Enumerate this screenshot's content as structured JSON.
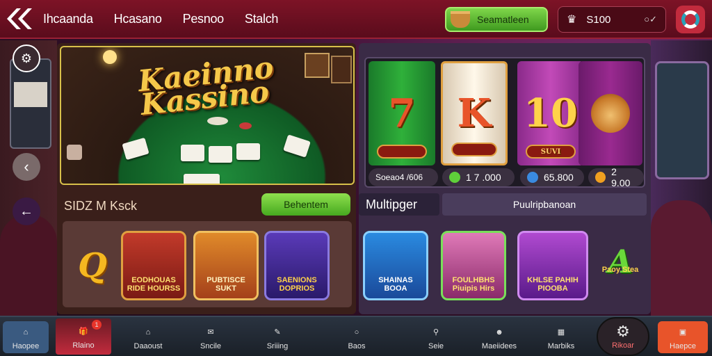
{
  "topbar": {
    "nav": [
      "Ihcaanda",
      "Hcasano",
      "Pesnoo",
      "Stalch"
    ],
    "promo_label": "Seamatleen",
    "balance": "S100",
    "balance_chevron": "○✓"
  },
  "hero": {
    "title_line1": "Kaeinno",
    "title_line2": "Kassino"
  },
  "left_section": {
    "title": "SIDZ M Ksck",
    "button": "Behentem",
    "games": [
      {
        "letter": "Q",
        "label": ""
      },
      {
        "label": "EODHOUAS\nRIDE HOURSS"
      },
      {
        "label": "PUBTISCE\nSUKT"
      },
      {
        "label": "SAENIONS\nDOPRIOS"
      }
    ]
  },
  "slots": {
    "reels": [
      {
        "symbol": "7",
        "label": ""
      },
      {
        "symbol": "K",
        "label": ""
      },
      {
        "symbol": "10",
        "label": "SUVI"
      },
      {
        "symbol": "",
        "label": ""
      }
    ],
    "stats": [
      "Soeao4 /606",
      "1 7 .000",
      "65.800",
      "2 9.00"
    ]
  },
  "multiplayer": {
    "title": "Multipger",
    "bar_label": "Puulripbanoan",
    "games": [
      {
        "label": "SHAINAS\nBOOA"
      },
      {
        "label": "FOULHBHS\nPiuipis Hirs"
      },
      {
        "label": "KHLSE PAHIH\nPIOOBA"
      },
      {
        "letter": "A",
        "label": "Paoy Stea"
      }
    ]
  },
  "bottom_nav": [
    "Haopee",
    "Rlaino",
    "Daaoust",
    "Sncile",
    "Sriiing",
    "Baos",
    "Seie",
    "Maeiidees",
    "Marbiks",
    "Rikoar",
    "Haepce"
  ],
  "badge": "1",
  "colors": {
    "accent_green": "#5dbb2e",
    "topbar": "#7d1326",
    "gold": "#f5c84a",
    "orange_btn": "#e8542a"
  }
}
